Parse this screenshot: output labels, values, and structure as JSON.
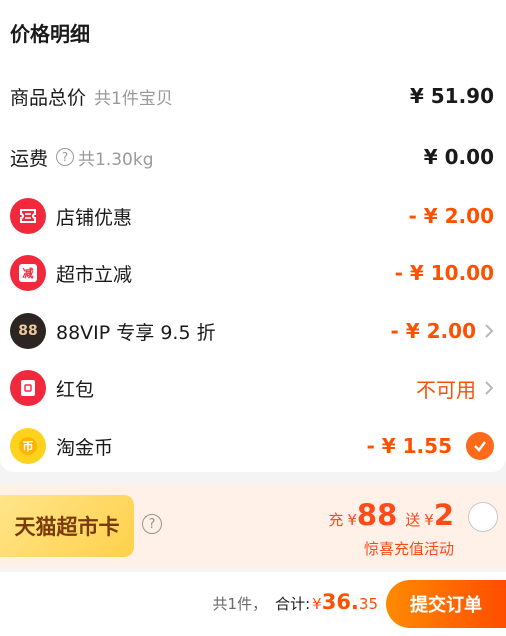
{
  "header": {
    "title": "价格明细"
  },
  "rows": {
    "goods": {
      "label": "商品总价",
      "sub": "共1件宝贝",
      "amount": "¥ 51.90"
    },
    "shipping": {
      "label": "运费",
      "sub": "共1.30kg",
      "amount": "¥ 0.00",
      "icon": "question-icon"
    },
    "store_discount": {
      "label": "店铺优惠",
      "amount": "- ¥ 2.00",
      "icon": "coupon-icon",
      "color": "#f2283c"
    },
    "market_discount": {
      "label": "超市立减",
      "amount": "- ¥ 10.00",
      "icon": "reduce-icon",
      "icon_text": "减",
      "color": "#f2283c"
    },
    "vip": {
      "label": "88VIP 专享 9.5 折",
      "amount": "- ¥ 2.00",
      "icon": "88vip-icon",
      "icon_text": "88",
      "color": "#2c2521"
    },
    "red_packet": {
      "label": "红包",
      "amount": "不可用",
      "icon": "red-packet-icon",
      "color": "#f2283c"
    },
    "coins": {
      "label": "淘金币",
      "amount": "- ¥ 1.55",
      "icon": "gold-coin-icon",
      "checked": true,
      "color": "#ffd21e"
    }
  },
  "tmall_card": {
    "label": "天猫超市卡",
    "recharge_prefix": "充",
    "recharge_currency": "¥",
    "recharge_amount": "88",
    "gift_prefix": "送",
    "gift_currency": "¥",
    "gift_amount": "2",
    "activity": "惊喜充值活动",
    "selected": false
  },
  "footer": {
    "count": "共1件，",
    "total_label": "合计:",
    "currency": "¥",
    "total_int": " 36.",
    "total_dec": "35",
    "submit_label": "提交订单"
  },
  "colors": {
    "accent": "#ff5000",
    "primary_text": "#1a1a1a",
    "muted_text": "#9a9a9a"
  }
}
